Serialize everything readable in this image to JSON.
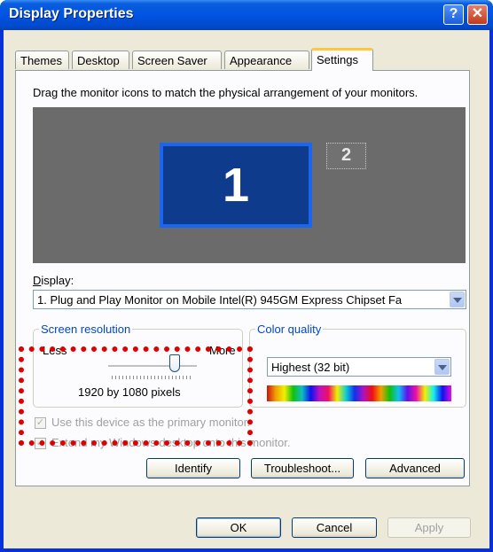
{
  "window": {
    "title": "Display Properties",
    "help": "?",
    "close": "X"
  },
  "tabs": [
    "Themes",
    "Desktop",
    "Screen Saver",
    "Appearance",
    "Settings"
  ],
  "instruction": "Drag the monitor icons to match the physical arrangement of your monitors.",
  "monitors": [
    "1",
    "2"
  ],
  "display": {
    "label": "Display:",
    "value": "1. Plug and Play Monitor on Mobile Intel(R) 945GM Express Chipset Fa"
  },
  "resolution": {
    "legend": "Screen resolution",
    "less": "Less",
    "more": "More",
    "value": "1920 by 1080 pixels",
    "slider_fraction": 0.75
  },
  "color_quality": {
    "legend": "Color quality",
    "value": "Highest (32 bit)"
  },
  "checkboxes": [
    {
      "label": "Use this device as the primary monitor.",
      "checked": true
    },
    {
      "label": "Extend my Windows desktop onto this monitor.",
      "checked": true
    }
  ],
  "panel_buttons": {
    "identify": "Identify",
    "troubleshoot": "Troubleshoot...",
    "advanced": "Advanced"
  },
  "dialog_buttons": {
    "ok": "OK",
    "cancel": "Cancel",
    "apply": "Apply"
  },
  "colors": {
    "highlight_box": "#e00000",
    "monitor_active": "#0f3b8c",
    "title_bar": "#0054e3"
  }
}
